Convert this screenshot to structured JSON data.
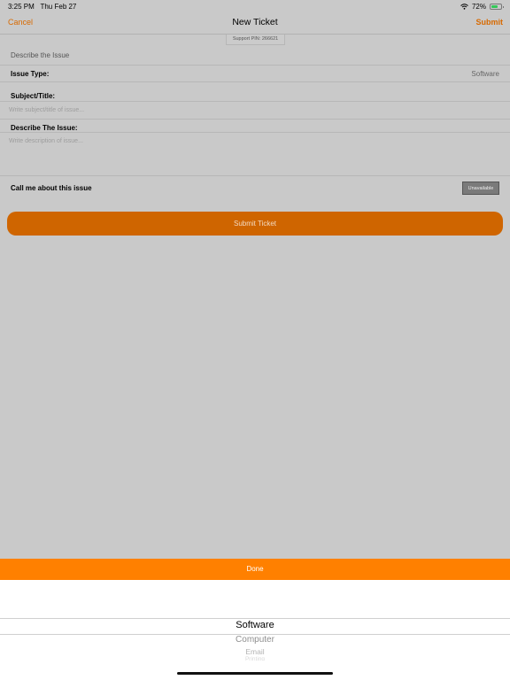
{
  "status_bar": {
    "time": "3:25 PM",
    "date": "Thu Feb 27",
    "battery_percent": "72%",
    "battery_level": 0.72,
    "wifi_icon": "wifi-icon",
    "battery_icon": "battery-icon"
  },
  "nav": {
    "cancel": "Cancel",
    "title": "New Ticket",
    "submit": "Submit"
  },
  "support_pin": "Support PIN: 266621",
  "form": {
    "section_header": "Describe the Issue",
    "issue_type_label": "Issue Type:",
    "issue_type_value": "Software",
    "subject_label": "Subject/Title:",
    "subject_placeholder": "Write subject/title of issue...",
    "describe_label": "Describe The Issue:",
    "describe_placeholder": "Write description of issue...",
    "call_label": "Call me about this issue",
    "call_status": "Unavailable"
  },
  "submit_ticket": "Submit Ticket",
  "picker": {
    "done": "Done",
    "options": [
      "Software",
      "Computer",
      "Email",
      "Printing"
    ]
  },
  "colors": {
    "accent": "#d86a00",
    "button": "#cf6500",
    "done_bar": "#ff8000",
    "background": "#c9c9c9"
  }
}
